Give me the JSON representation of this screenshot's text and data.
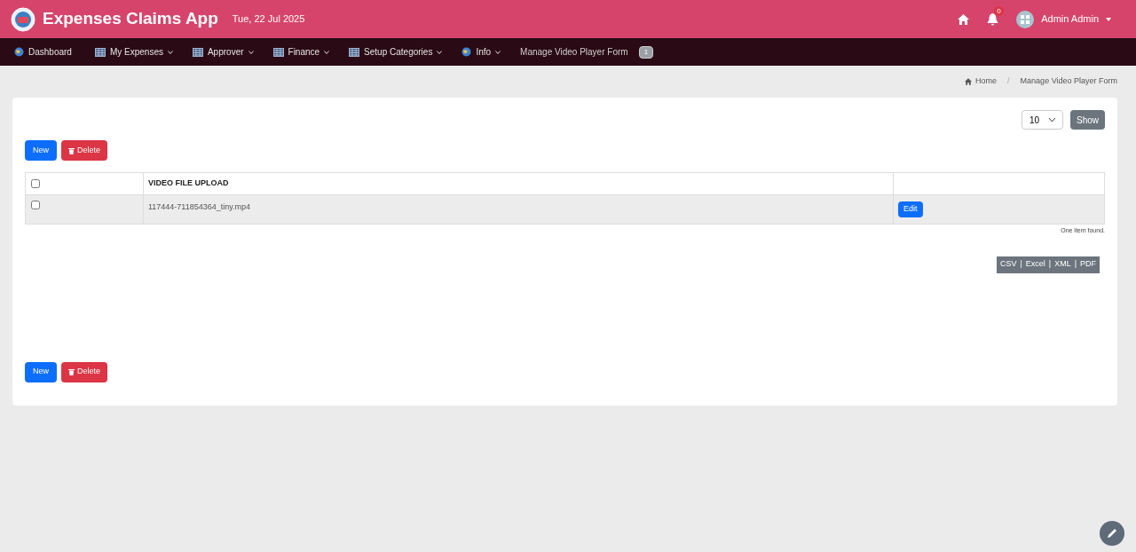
{
  "header": {
    "title": "Expenses Claims App",
    "date": "Tue, 22 Jul 2025",
    "notifications": "0",
    "user": "Admin Admin"
  },
  "nav": [
    {
      "label": "Dashboard",
      "kind": "link"
    },
    {
      "label": "My Expenses",
      "kind": "dropdown"
    },
    {
      "label": "Approver",
      "kind": "dropdown"
    },
    {
      "label": "Finance",
      "kind": "dropdown"
    },
    {
      "label": "Setup Categories",
      "kind": "dropdown"
    },
    {
      "label": "Info",
      "kind": "dropdown"
    },
    {
      "label": "Manage Video Player Form",
      "kind": "current"
    }
  ],
  "nav_badge": "1",
  "breadcrumb": {
    "items": [
      "Home",
      "Manage Video Player Form"
    ],
    "separator": "/"
  },
  "page_size": {
    "value": "10",
    "button": "Show"
  },
  "buttons_top": {
    "new": "New",
    "delete": "Delete"
  },
  "buttons_bottom": {
    "new": "New",
    "delete": "Delete"
  },
  "table": {
    "columns": [
      "VIDEO FILE UPLOAD"
    ],
    "header_checked": false,
    "rows": [
      {
        "checked": false,
        "file": "117444-711854364_tiny.mp4",
        "action": "Edit"
      }
    ]
  },
  "summary": "One item found.",
  "export": {
    "links": [
      "CSV",
      "Excel",
      "XML",
      "PDF"
    ],
    "separator": "|"
  }
}
